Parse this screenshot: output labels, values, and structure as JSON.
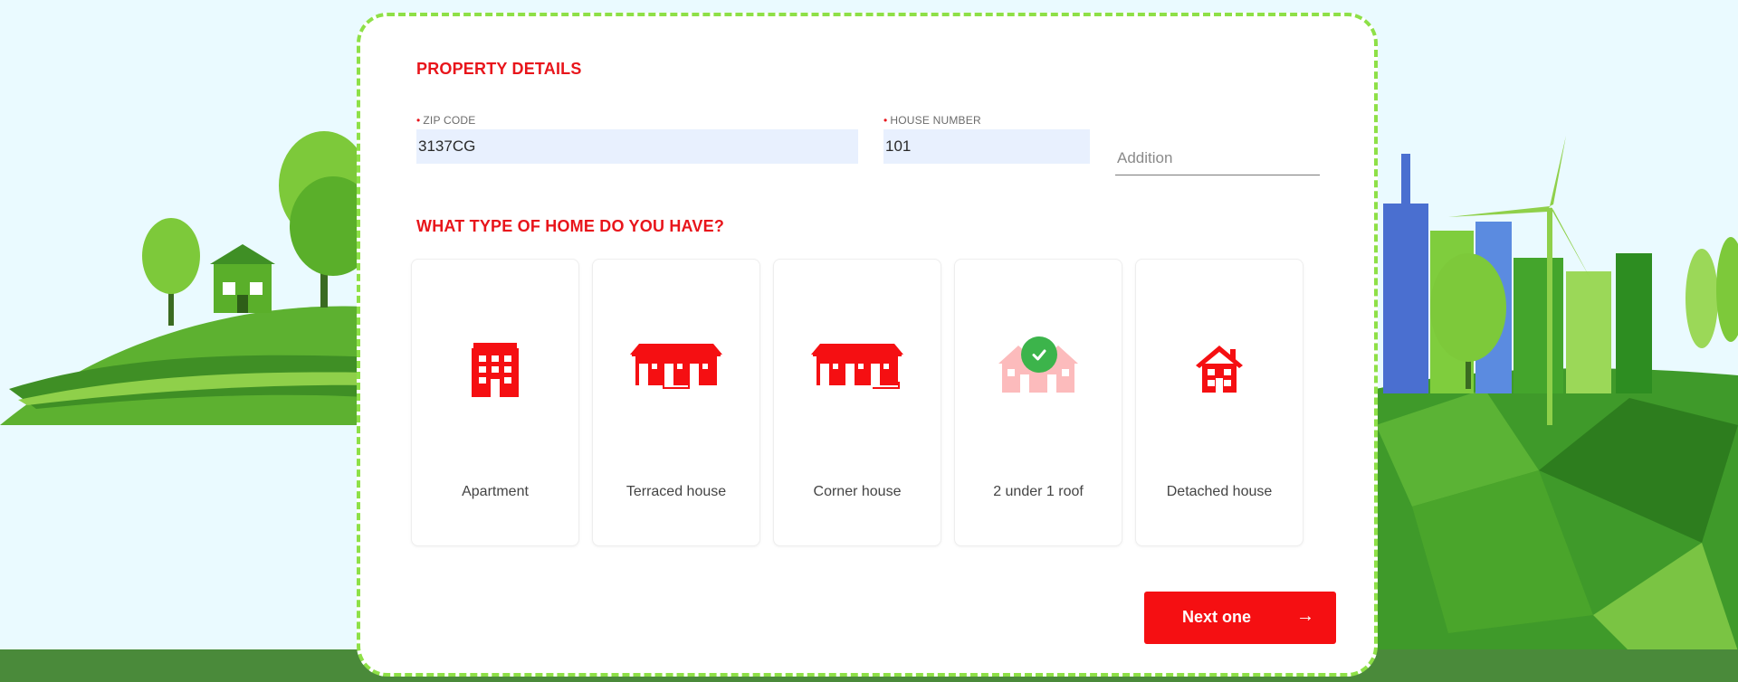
{
  "property": {
    "section_title": "PROPERTY DETAILS",
    "zip": {
      "label": "ZIP CODE",
      "required_mark": "•",
      "value": "3137CG"
    },
    "house_number": {
      "label": "HOUSE NUMBER",
      "required_mark": "•",
      "value": "101"
    },
    "addition": {
      "placeholder": "Addition",
      "value": ""
    }
  },
  "home_type": {
    "question": "WHAT TYPE OF HOME DO YOU HAVE?",
    "options": [
      {
        "label": "Apartment",
        "icon": "apartment-icon",
        "selected": false
      },
      {
        "label": "Terraced house",
        "icon": "terraced-house-icon",
        "selected": false
      },
      {
        "label": "Corner house",
        "icon": "corner-house-icon",
        "selected": false
      },
      {
        "label": "2 under 1 roof",
        "icon": "semi-detached-house-icon",
        "selected": true
      },
      {
        "label": "Detached house",
        "icon": "detached-house-icon",
        "selected": false
      }
    ]
  },
  "actions": {
    "next_label": "Next one",
    "next_arrow": "→"
  },
  "colors": {
    "accent": "#f50f12",
    "heading": "#e8151b",
    "border_dash": "#8ee047",
    "check": "#3cb44b",
    "input_fill": "#e8f0fe"
  }
}
